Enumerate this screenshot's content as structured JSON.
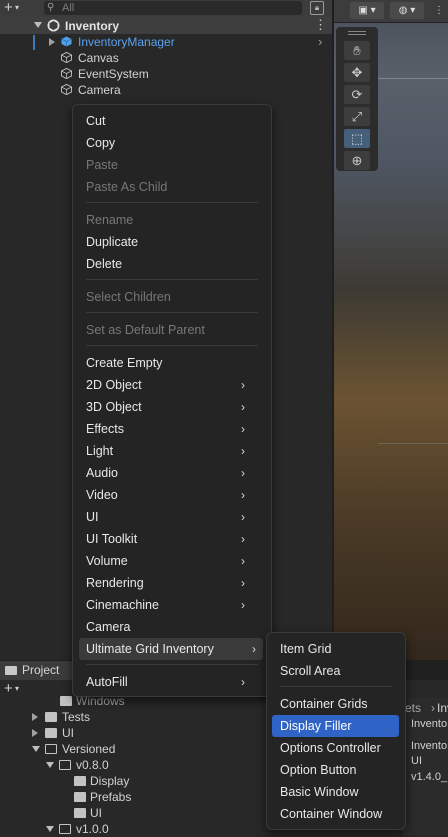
{
  "hierarchy": {
    "search_placeholder": "All",
    "add_label": "+",
    "scene_name": "Inventory",
    "items": [
      {
        "label": "InventoryManager",
        "selected": true
      },
      {
        "label": "Canvas"
      },
      {
        "label": "EventSystem"
      },
      {
        "label": "Camera"
      }
    ]
  },
  "context_menu": {
    "items": [
      {
        "label": "Cut"
      },
      {
        "label": "Copy"
      },
      {
        "label": "Paste",
        "disabled": true
      },
      {
        "label": "Paste As Child",
        "disabled": true
      },
      {
        "label": "Rename",
        "disabled": true
      },
      {
        "label": "Duplicate"
      },
      {
        "label": "Delete"
      },
      {
        "label": "Select Children",
        "disabled": true
      },
      {
        "label": "Set as Default Parent",
        "disabled": true
      },
      {
        "label": "Create Empty"
      },
      {
        "label": "2D Object",
        "submenu": true
      },
      {
        "label": "3D Object",
        "submenu": true
      },
      {
        "label": "Effects",
        "submenu": true
      },
      {
        "label": "Light",
        "submenu": true
      },
      {
        "label": "Audio",
        "submenu": true
      },
      {
        "label": "Video",
        "submenu": true
      },
      {
        "label": "UI",
        "submenu": true
      },
      {
        "label": "UI Toolkit",
        "submenu": true
      },
      {
        "label": "Volume",
        "submenu": true
      },
      {
        "label": "Rendering",
        "submenu": true
      },
      {
        "label": "Cinemachine",
        "submenu": true
      },
      {
        "label": "Camera"
      },
      {
        "label": "Ultimate Grid Inventory",
        "submenu": true,
        "highlighted": true
      },
      {
        "label": "AutoFill",
        "submenu": true
      }
    ],
    "chevron": "›"
  },
  "submenu": {
    "items": [
      {
        "label": "Item Grid"
      },
      {
        "label": "Scroll Area"
      },
      {
        "label": "Container Grids"
      },
      {
        "label": "Display Filler",
        "selected": true
      },
      {
        "label": "Options Controller"
      },
      {
        "label": "Option Button"
      },
      {
        "label": "Basic Window"
      },
      {
        "label": "Container Window"
      }
    ]
  },
  "project": {
    "tab_label": "Project",
    "add_label": "+",
    "tree": [
      {
        "label": "Windows"
      },
      {
        "label": "Tests"
      },
      {
        "label": "UI"
      },
      {
        "label": "Versioned"
      },
      {
        "label": "v0.8.0"
      },
      {
        "label": "Display"
      },
      {
        "label": "Prefabs"
      },
      {
        "label": "UI"
      },
      {
        "label": "v1.0.0"
      }
    ],
    "right_fragments": [
      "ets",
      "Invent",
      "Invento",
      "Invento",
      "UI",
      "v1.4.0_"
    ]
  },
  "colors": {
    "accent": "#2f63c6",
    "hierarchy_selected_text": "#5aa2f0",
    "menu_bg": "#242424"
  }
}
